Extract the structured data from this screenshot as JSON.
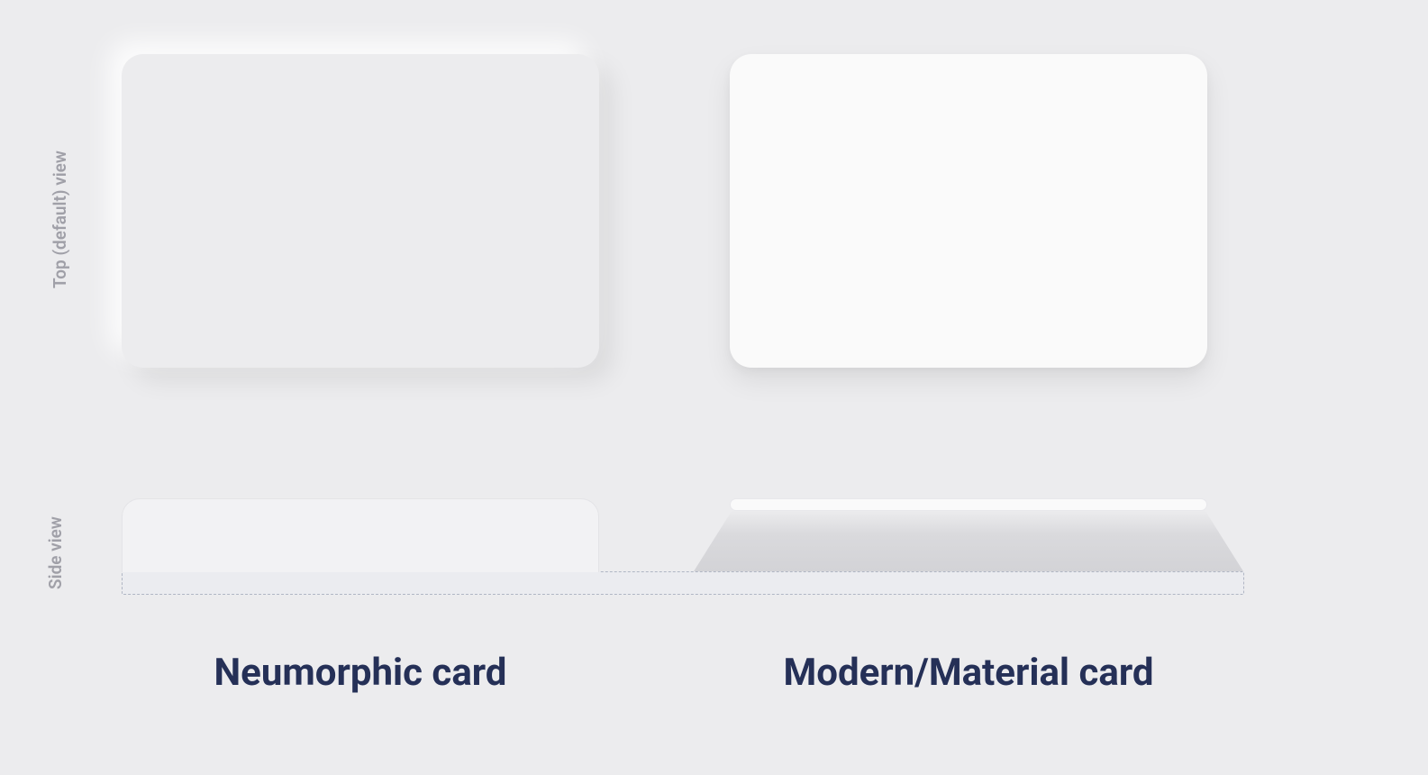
{
  "labels": {
    "row_top": "Top (default) view",
    "row_side": "Side view"
  },
  "columns": {
    "left_title": "Neumorphic card",
    "right_title": "Modern/Material card"
  },
  "colors": {
    "background": "#ececee",
    "text_dark": "#253057",
    "text_muted": "#a0a0a8",
    "material_card": "#fafafa",
    "baseline_border": "#b0b6c4"
  }
}
